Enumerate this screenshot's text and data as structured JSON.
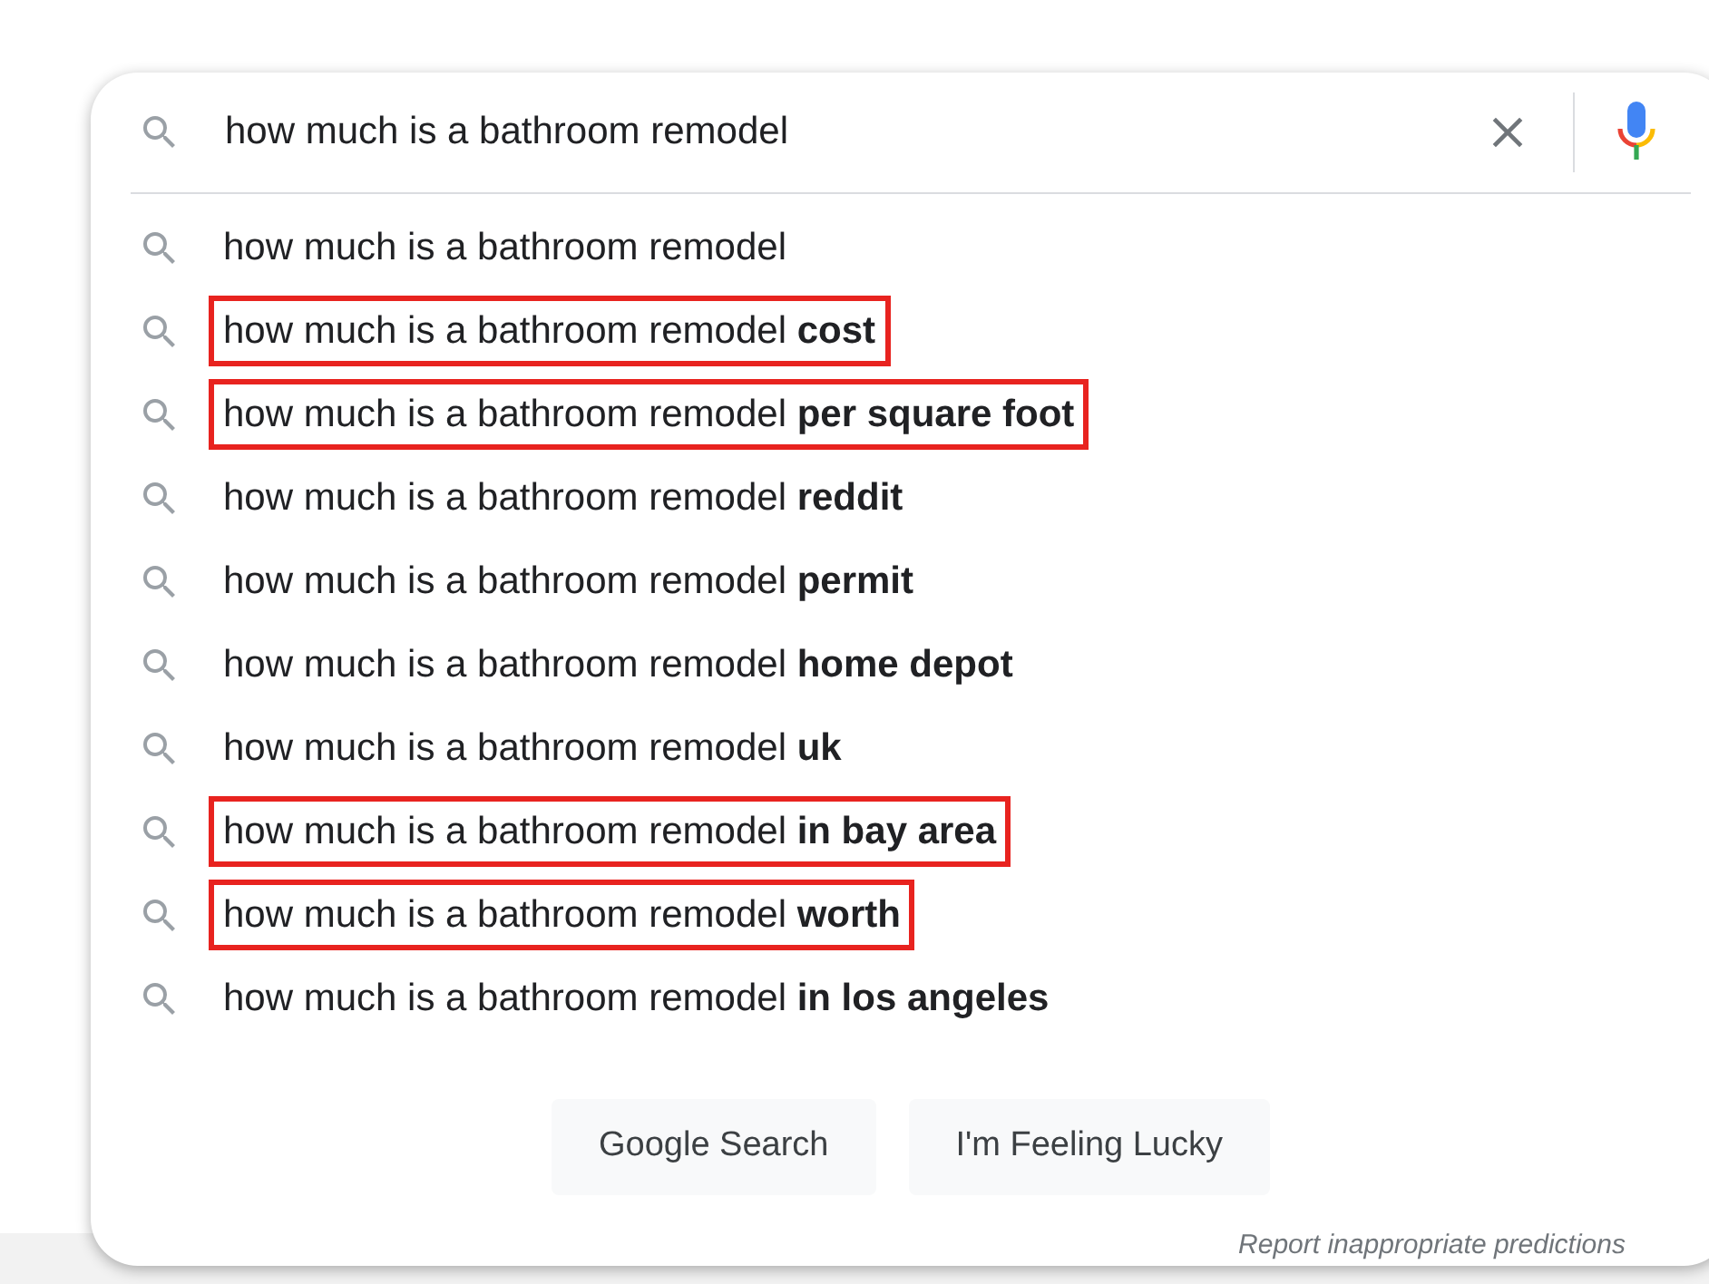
{
  "search": {
    "value": "how much is a bathroom remodel"
  },
  "suggestions": [
    {
      "text": "how much is a bathroom remodel",
      "highlighted": false
    },
    {
      "text": "how much is a bathroom remodel **cost**",
      "highlighted": true
    },
    {
      "text": "how much is a bathroom remodel **per square foot**",
      "highlighted": true
    },
    {
      "text": "how much is a bathroom remodel **reddit**",
      "highlighted": false
    },
    {
      "text": "how much is a bathroom remodel **permit**",
      "highlighted": false
    },
    {
      "text": "how much is a bathroom remodel **home depot**",
      "highlighted": false
    },
    {
      "text": "how much is a bathroom remodel **uk**",
      "highlighted": false
    },
    {
      "text": "how much is a bathroom remodel **in bay area**",
      "highlighted": true
    },
    {
      "text": "how much is a bathroom remodel **worth**",
      "highlighted": true
    },
    {
      "text": "how much is a bathroom remodel **in los angeles**",
      "highlighted": false
    }
  ],
  "buttons": [
    "Google Search",
    "I'm Feeling Lucky"
  ],
  "report_link": "Report inappropriate predictions"
}
